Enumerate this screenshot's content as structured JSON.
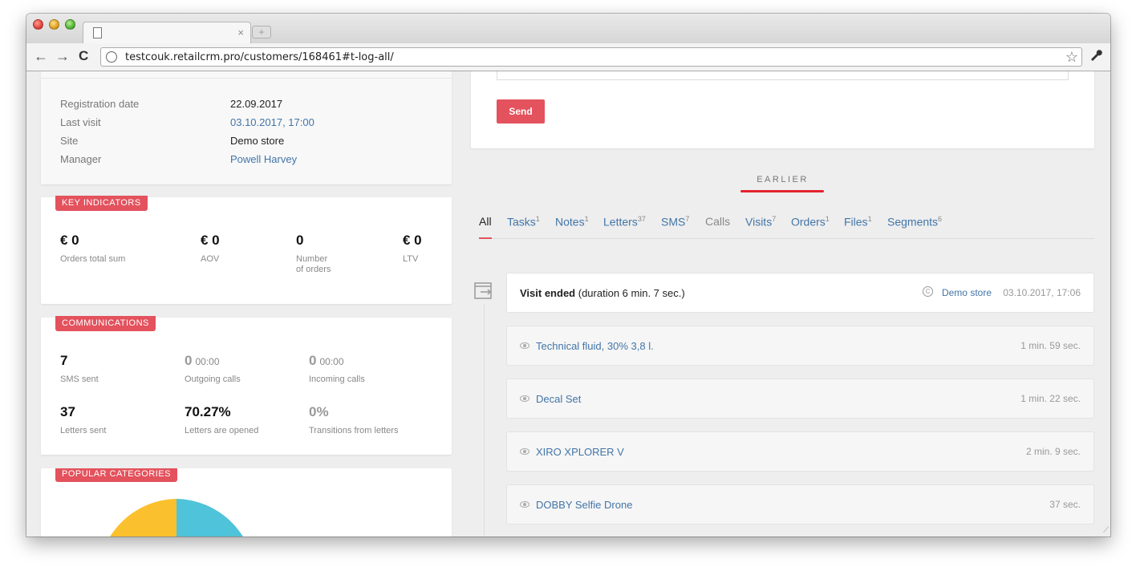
{
  "browser": {
    "tab_close": "×",
    "new_tab": "+",
    "url": "testcouk.retailcrm.pro/customers/168461#t-log-all/",
    "back": "←",
    "forward": "→",
    "reload": "C",
    "bookmark": "☆",
    "settings": "🔧"
  },
  "customer_info": [
    {
      "label": "Registration date",
      "value": "22.09.2017",
      "link": false
    },
    {
      "label": "Last visit",
      "value": "03.10.2017, 17:00",
      "link": true
    },
    {
      "label": "Site",
      "value": "Demo store",
      "link": false
    },
    {
      "label": "Manager",
      "value": "Powell Harvey",
      "link": true
    }
  ],
  "key_indicators": {
    "title": "KEY INDICATORS",
    "items": [
      {
        "value": "€ 0",
        "label": "Orders total sum"
      },
      {
        "value": "€ 0",
        "label": "AOV"
      },
      {
        "value": "0",
        "label": "Number of orders"
      },
      {
        "value": "€ 0",
        "label": "LTV"
      }
    ]
  },
  "communications": {
    "title": "COMMUNICATIONS",
    "items": [
      {
        "value": "7",
        "sub": "",
        "label": "SMS sent"
      },
      {
        "value": "0",
        "sub": "00:00",
        "label": "Outgoing calls"
      },
      {
        "value": "0",
        "sub": "00:00",
        "label": "Incoming calls"
      },
      {
        "value": "37",
        "sub": "",
        "label": "Letters sent"
      },
      {
        "value": "70.27%",
        "sub": "",
        "label": "Letters are opened"
      },
      {
        "value": "0%",
        "sub": "",
        "label": "Transitions from letters"
      }
    ]
  },
  "popular_categories": {
    "title": "POPULAR CATEGORIES",
    "colors": [
      "#fbc02d",
      "#4fc3d9"
    ]
  },
  "composer": {
    "send_label": "Send"
  },
  "history": {
    "section_title": "EARLIER",
    "tabs": [
      {
        "label": "All",
        "count": ""
      },
      {
        "label": "Tasks",
        "count": "1"
      },
      {
        "label": "Notes",
        "count": "1"
      },
      {
        "label": "Letters",
        "count": "37"
      },
      {
        "label": "SMS",
        "count": "7"
      },
      {
        "label": "Calls",
        "count": ""
      },
      {
        "label": "Visits",
        "count": "7"
      },
      {
        "label": "Orders",
        "count": "1"
      },
      {
        "label": "Files",
        "count": "1"
      },
      {
        "label": "Segments",
        "count": "6"
      }
    ],
    "visit_event": {
      "title": "Visit ended",
      "detail": "(duration 6 min. 7 sec.)",
      "store": "Demo store",
      "datetime": "03.10.2017, 17:06"
    },
    "page_views": [
      {
        "product": "Technical fluid, 30% 3,8 l.",
        "duration": "1 min. 59 sec."
      },
      {
        "product": "Decal Set",
        "duration": "1 min. 22 sec."
      },
      {
        "product": "XIRO XPLORER V",
        "duration": "2 min. 9 sec."
      },
      {
        "product": "DOBBY Selfie Drone",
        "duration": "37 sec."
      }
    ]
  },
  "colors": {
    "accent": "#e3525d",
    "link": "#4275a8",
    "earlier_underline": "#e3232f"
  }
}
